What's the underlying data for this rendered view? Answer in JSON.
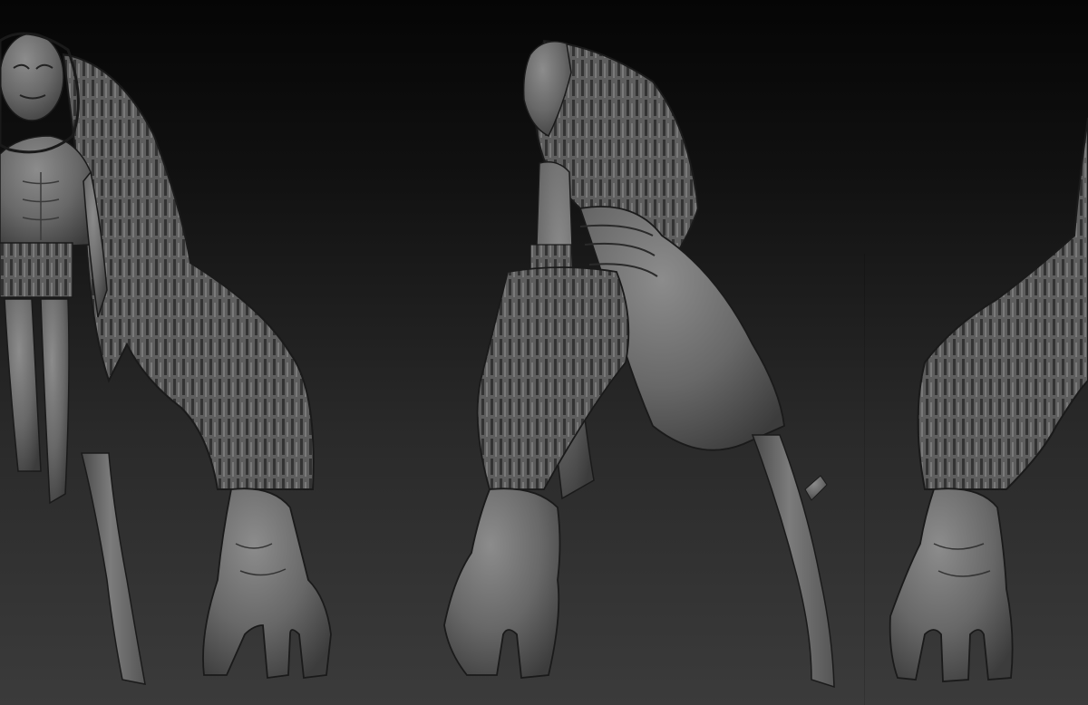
{
  "scene": {
    "kind": "3d-sculpt-preview",
    "views": [
      "front",
      "side",
      "back"
    ],
    "material": "matte grey clay",
    "colors": {
      "background_top": "#050505",
      "background_bottom": "#3b3b3b",
      "clay_light": "#8a8a8a",
      "clay_mid": "#6a6a6a",
      "clay_dark": "#3a3a3a",
      "outline": "#1a1a1a"
    }
  }
}
